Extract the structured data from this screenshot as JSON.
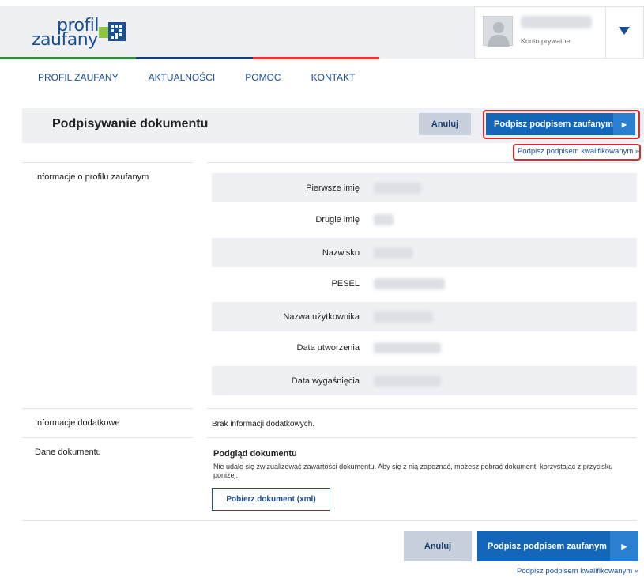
{
  "header": {
    "logo_top": "profil",
    "logo_bottom": "zaufany",
    "user_type": "Konto prywatne",
    "stripe_colors": [
      "#2f8e3c",
      "#1b3f6b",
      "#e03a2a"
    ]
  },
  "nav": {
    "items": [
      "PROFIL ZAUFANY",
      "AKTUALNOŚCI",
      "POMOC",
      "KONTAKT"
    ]
  },
  "toolbar": {
    "title": "Podpisywanie dokumentu",
    "cancel_label": "Anuluj",
    "sign_label": "Podpisz podpisem zaufanym",
    "qualified_link": "Podpisz podpisem kwalifikowanym »"
  },
  "profile_info": {
    "section_label": "Informacje o profilu zaufanym",
    "rows": [
      {
        "label": "Pierwsze imię"
      },
      {
        "label": "Drugie imię"
      },
      {
        "label": "Nazwisko"
      },
      {
        "label": "PESEL"
      },
      {
        "label": "Nazwa użytkownika"
      },
      {
        "label": "Data utworzenia"
      },
      {
        "label": "Data wygaśnięcia"
      }
    ]
  },
  "additional_info": {
    "section_label": "Informacje dodatkowe",
    "text": "Brak informacji dodatkowych."
  },
  "document": {
    "section_label": "Dane dokumentu",
    "preview_title": "Podgląd dokumentu",
    "preview_text": "Nie udało się zwizualizować zawartości dokumentu. Aby się z nią zapoznać, możesz pobrać dokument, korzystając z przycisku poniżej.",
    "download_label": "Pobierz dokument (xml)"
  },
  "footer_actions": {
    "cancel_label": "Anuluj",
    "sign_label": "Podpisz podpisem zaufanym",
    "qualified_link": "Podpisz podpisem kwalifikowanym »"
  },
  "colors": {
    "accent": "#1466b8",
    "highlight": "#e02828"
  }
}
